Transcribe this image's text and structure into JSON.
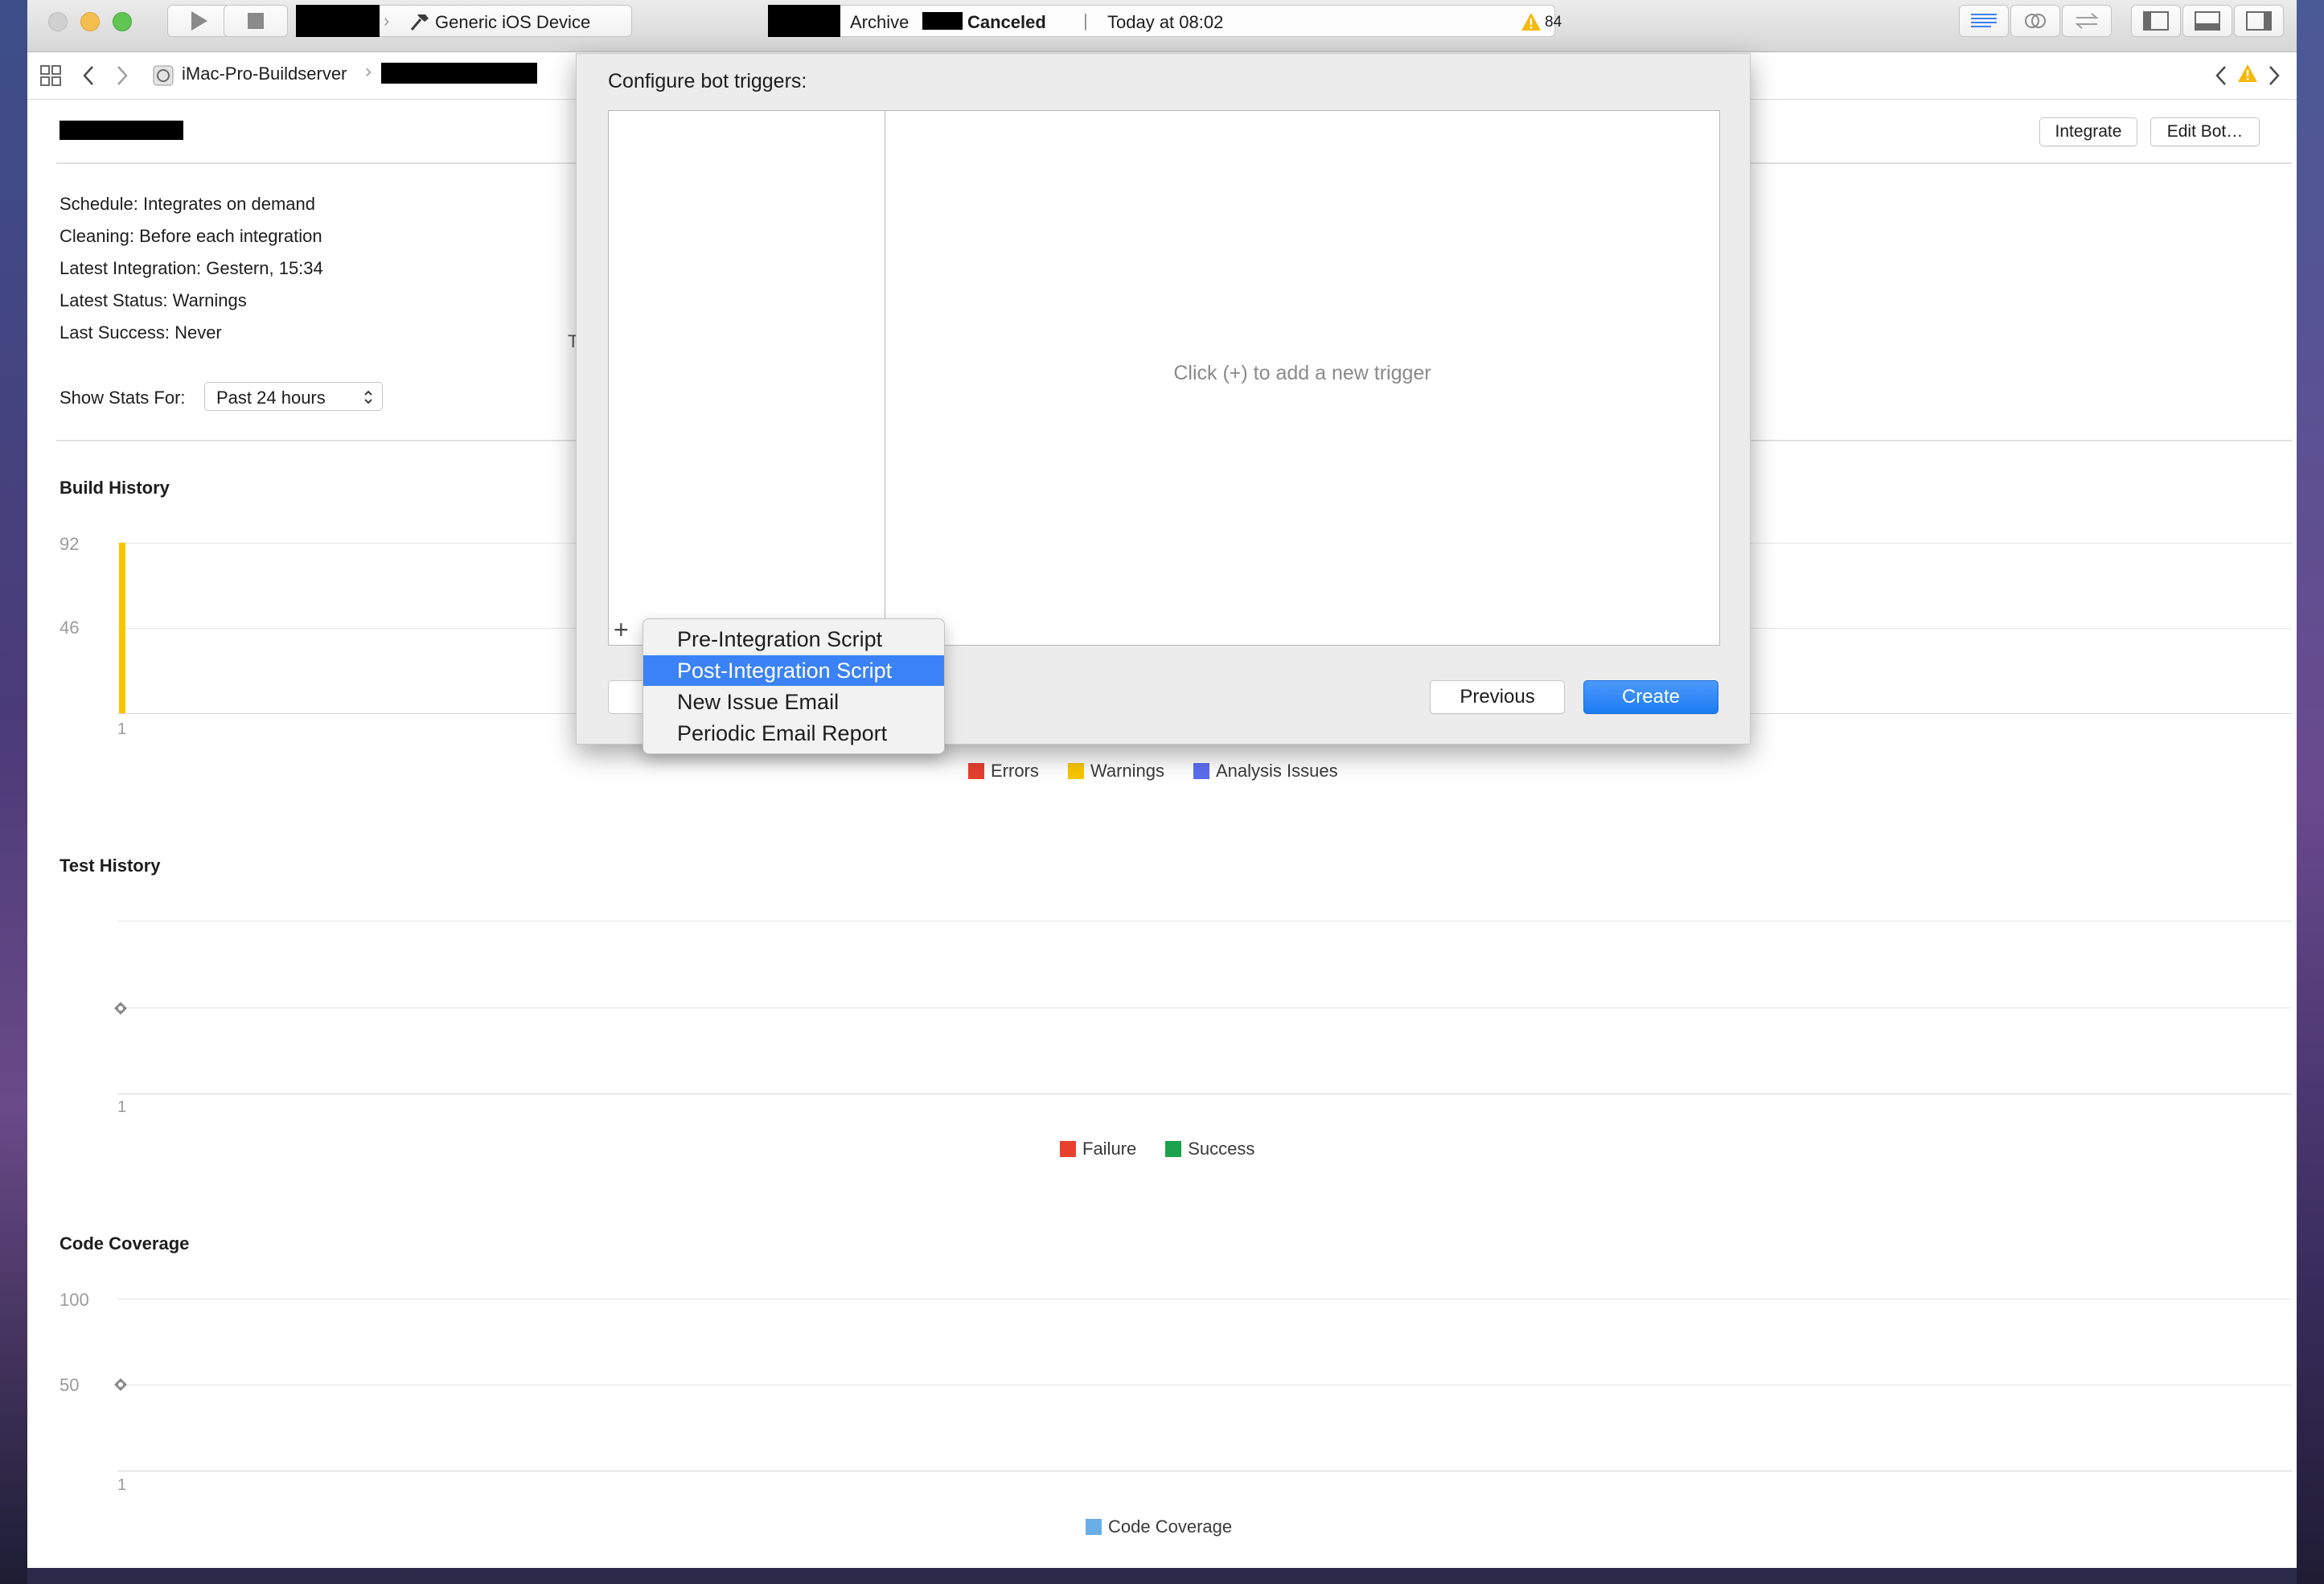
{
  "toolbar": {
    "scheme_device": "Generic iOS Device",
    "activity_action": "Archive",
    "activity_status": "Canceled",
    "activity_separator": "|",
    "activity_time": "Today at 08:02",
    "warning_count": "84"
  },
  "jumpbar": {
    "server": "iMac-Pro-Buildserver"
  },
  "bot": {
    "integrate_label": "Integrate",
    "edit_label": "Edit Bot…",
    "schedule": "Schedule: Integrates on demand",
    "cleaning": "Cleaning: Before each integration",
    "latest_integration": "Latest Integration: Gestern, 15:34",
    "latest_status": "Latest Status: Warnings",
    "last_success": "Last Success: Never",
    "stats_label": "Show Stats For:",
    "stats_value": "Past 24 hours",
    "partial_char": "T"
  },
  "build_history": {
    "title": "Build History",
    "y_ticks": [
      "92",
      "46"
    ],
    "x_tick": "1",
    "legend": [
      "Errors",
      "Warnings",
      "Analysis Issues"
    ]
  },
  "test_history": {
    "title": "Test History",
    "x_tick": "1",
    "legend": [
      "Failure",
      "Success"
    ]
  },
  "code_coverage": {
    "title": "Code Coverage",
    "y_ticks": [
      "100",
      "50"
    ],
    "x_tick": "1",
    "legend": [
      "Code Coverage"
    ]
  },
  "sheet": {
    "title": "Configure bot triggers:",
    "empty_text": "Click (+) to add a new trigger",
    "add_symbol": "+",
    "previous_label": "Previous",
    "create_label": "Create"
  },
  "menu": {
    "items": [
      "Pre-Integration Script",
      "Post-Integration Script",
      "New Issue Email",
      "Periodic Email Report"
    ],
    "selected": "Post-Integration Script"
  },
  "colors": {
    "errors": "#e8402f",
    "warnings": "#f7c600",
    "analysis": "#5b6ef0",
    "failure": "#e8402f",
    "success": "#1aa34a",
    "coverage": "#6aaee8",
    "accent": "#3b82f6"
  },
  "chart_data": [
    {
      "type": "bar",
      "title": "Build History",
      "categories": [
        "1"
      ],
      "series": [
        {
          "name": "Errors",
          "values": [
            0
          ]
        },
        {
          "name": "Warnings",
          "values": [
            92
          ]
        },
        {
          "name": "Analysis Issues",
          "values": [
            0
          ]
        }
      ],
      "ylim": [
        0,
        92
      ],
      "grid": true,
      "legend": "bottom"
    },
    {
      "type": "scatter",
      "title": "Test History",
      "categories": [
        "1"
      ],
      "series": [
        {
          "name": "Failure",
          "values": [
            0
          ]
        },
        {
          "name": "Success",
          "values": [
            0
          ]
        }
      ],
      "grid": true,
      "legend": "bottom"
    },
    {
      "type": "line",
      "title": "Code Coverage",
      "categories": [
        "1"
      ],
      "series": [
        {
          "name": "Code Coverage",
          "values": [
            50
          ]
        }
      ],
      "ylim": [
        0,
        100
      ],
      "grid": true,
      "legend": "bottom"
    }
  ]
}
